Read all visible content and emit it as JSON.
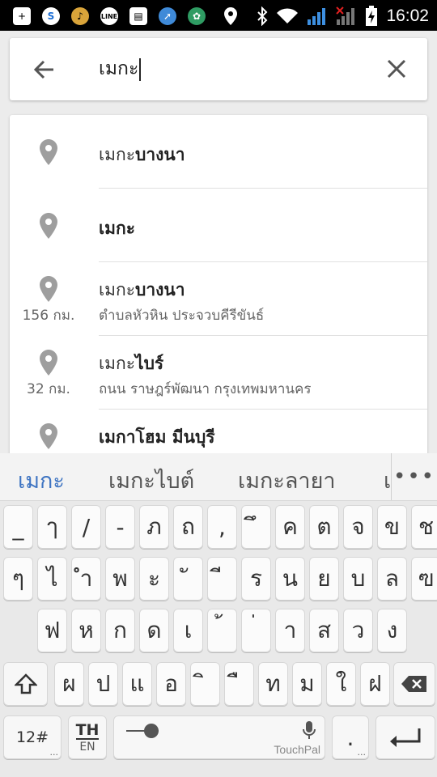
{
  "status_bar": {
    "time": "16:02",
    "left_icons": [
      "add-notification-icon",
      "skype-icon",
      "guitar-app-icon",
      "line-app-icon",
      "printer-icon",
      "rocket-app-icon",
      "gear-app-icon",
      "location-icon"
    ],
    "right_icons": [
      "bluetooth-icon",
      "wifi-icon",
      "signal-icon",
      "signal-x-icon",
      "battery-charging-icon"
    ]
  },
  "search": {
    "query": "เมกะ",
    "back_icon": "back-arrow-icon",
    "clear_icon": "close-icon"
  },
  "suggestions": [
    {
      "bold_prefix": "เมกะ",
      "rest": "บางนา",
      "distance": "",
      "subtitle": ""
    },
    {
      "bold_prefix": "เมกะ",
      "rest": "",
      "distance": "",
      "subtitle": ""
    },
    {
      "bold_prefix": "เมกะ",
      "rest": "บางนา",
      "distance": "156 กม.",
      "subtitle": "ตำบลหัวหิน ประจวบคีรีขันธ์"
    },
    {
      "bold_prefix": "เมกะ",
      "rest": "ไบร์",
      "distance": "32 กม.",
      "subtitle": "ถนน ราษฎร์พัฒนา กรุงเทพมหานคร"
    },
    {
      "bold_prefix": "เมกา",
      "rest": "โฮม มีนบุรี",
      "distance": "",
      "subtitle": ""
    }
  ],
  "keyboard": {
    "candidates": [
      "เมกะ",
      "เมกะไบต์",
      "เมกะลายา",
      "เ"
    ],
    "more_label": "•••",
    "row1": [
      "_",
      "ๅ",
      "/",
      "-",
      "ภ",
      "ถ",
      ",",
      "ึ",
      "ค",
      "ต",
      "จ",
      "ข",
      "ช"
    ],
    "row2": [
      "ๆ",
      "ไ",
      "ำ",
      "พ",
      "ะ",
      "ั",
      "ี",
      "ร",
      "น",
      "ย",
      "บ",
      "ล",
      "ฃ"
    ],
    "row3": [
      "ฟ",
      "ห",
      "ก",
      "ด",
      "เ",
      "้",
      "่",
      "า",
      "ส",
      "ว",
      "ง"
    ],
    "row4": [
      "ผ",
      "ป",
      "แ",
      "อ",
      "ิ",
      "ื",
      "ท",
      "ม",
      "ใ",
      "ฝ"
    ],
    "numbers_key": "12#",
    "lang_key_top": "TH",
    "lang_key_bottom": "EN",
    "space_brand": "TouchPal",
    "period_key": ".",
    "ellipsis": "..."
  }
}
